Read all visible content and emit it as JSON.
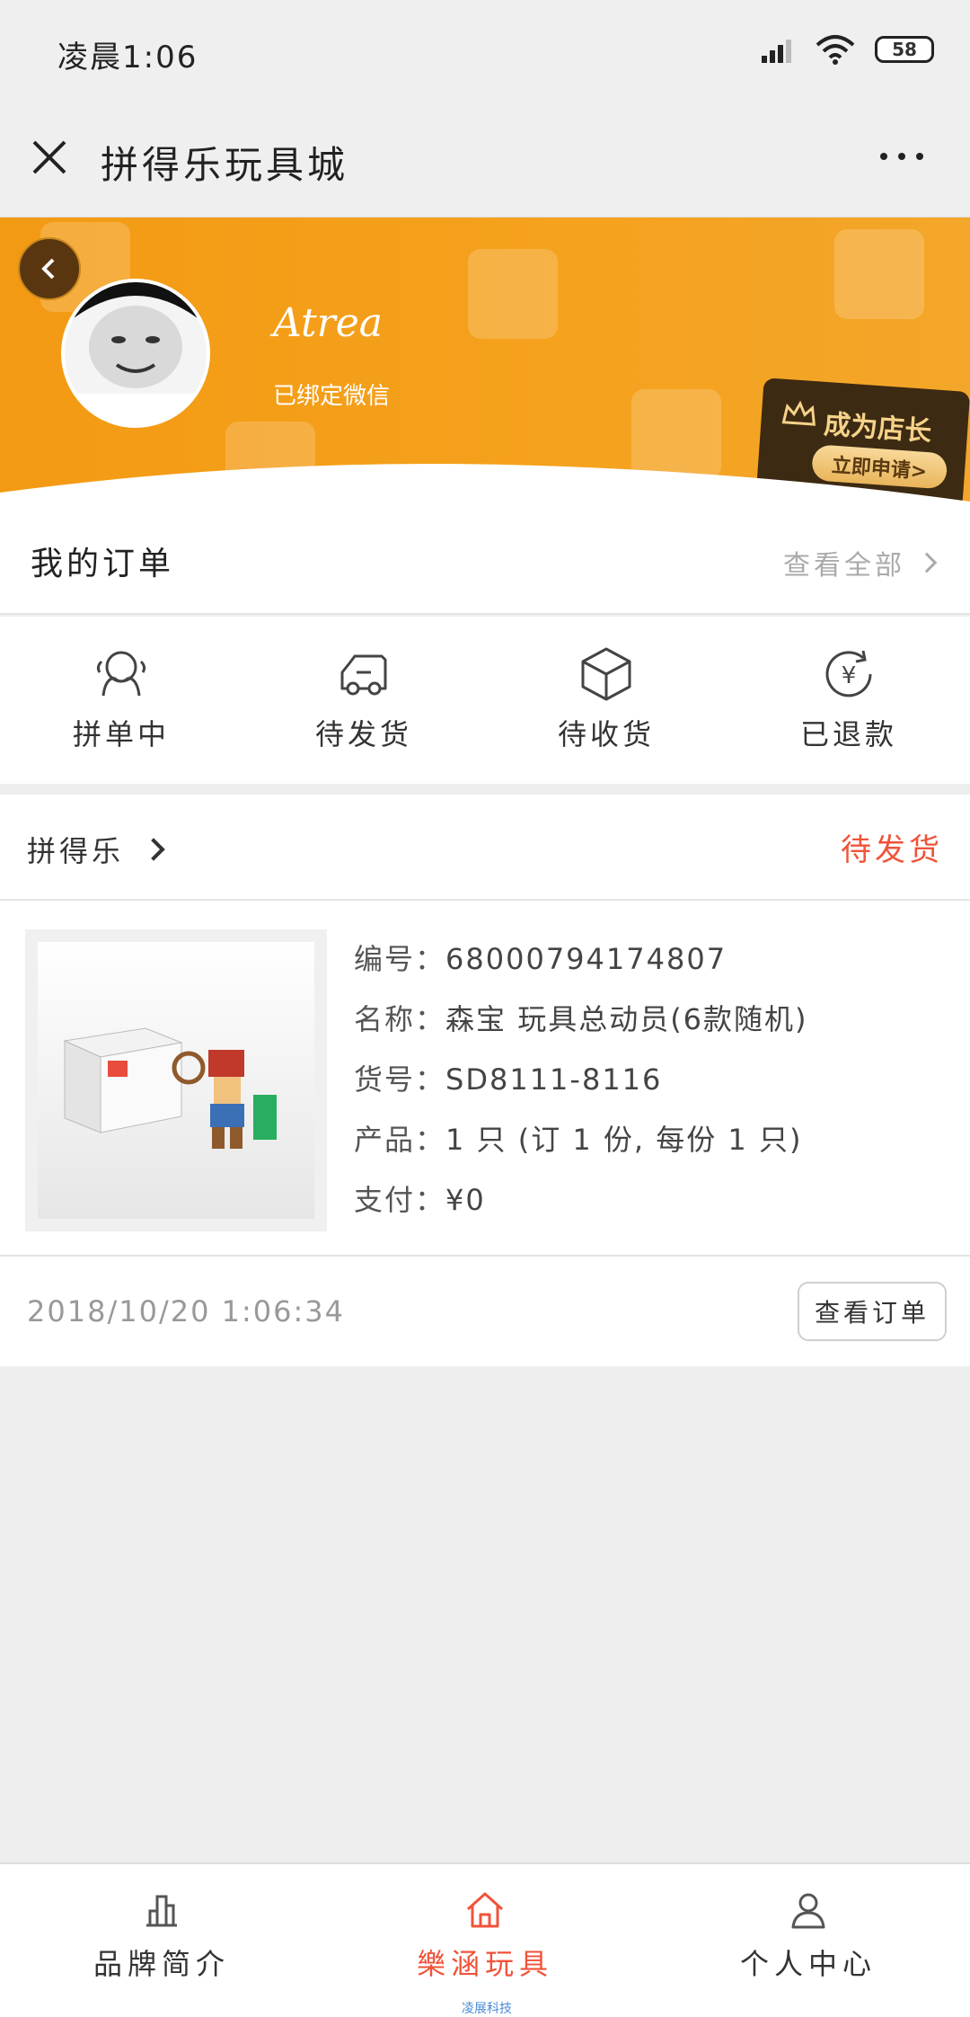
{
  "status_bar": {
    "time": "凌晨1:06",
    "battery": "58"
  },
  "titlebar": {
    "title": "拼得乐玩具城"
  },
  "profile": {
    "username": "Atrea",
    "bind_status": "已绑定微信",
    "shop_cta_title": "成为店长",
    "shop_cta_button": "立即申请>"
  },
  "orders": {
    "title": "我的订单",
    "view_all": "查看全部",
    "statuses": [
      {
        "label": "拼单中",
        "icon": "group-icon"
      },
      {
        "label": "待发货",
        "icon": "truck-icon"
      },
      {
        "label": "待收货",
        "icon": "package-icon"
      },
      {
        "label": "已退款",
        "icon": "refund-icon"
      }
    ]
  },
  "order": {
    "store": "拼得乐",
    "status": "待发货",
    "number_label": "编号：",
    "number": "68000794174807",
    "name_label": "名称：",
    "name": "森宝 玩具总动员(6款随机)",
    "sku_label": "货号：",
    "sku": "SD8111-8116",
    "product_label": "产品：",
    "product": "1 只 (订 1 份, 每份 1 只)",
    "pay_label": "支付：",
    "pay": "¥0",
    "time": "2018/10/20 1:06:34",
    "view_button": "查看订单"
  },
  "bottom_nav": {
    "items": [
      {
        "label": "品牌简介",
        "icon": "brand-chart-icon"
      },
      {
        "label": "樂涵玩具",
        "icon": "home-icon"
      },
      {
        "label": "个人中心",
        "icon": "user-icon"
      }
    ],
    "footnote": "凌展科技"
  },
  "colors": {
    "accent": "#f0533a",
    "header": "#f39a13"
  }
}
